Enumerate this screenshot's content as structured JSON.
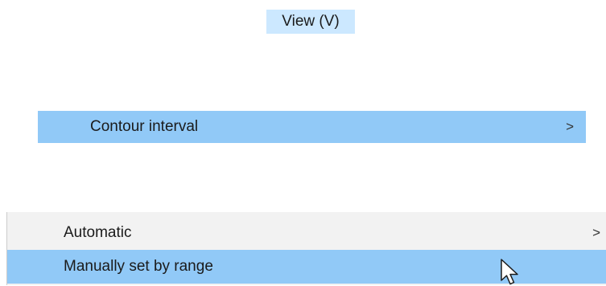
{
  "menu": {
    "title": "View (V)"
  },
  "submenu": {
    "item_label": "Contour interval",
    "item_chevron": ">"
  },
  "dropdown": {
    "items": [
      {
        "label": "Automatic",
        "chevron": ">"
      },
      {
        "label": "Manually set by range",
        "chevron": ""
      }
    ]
  },
  "colors": {
    "title_highlight": "#cce8ff",
    "selected_highlight": "#91c9f7",
    "menu_background": "#f2f2f2"
  },
  "icons": {
    "cursor": "mouse-pointer-icon"
  }
}
